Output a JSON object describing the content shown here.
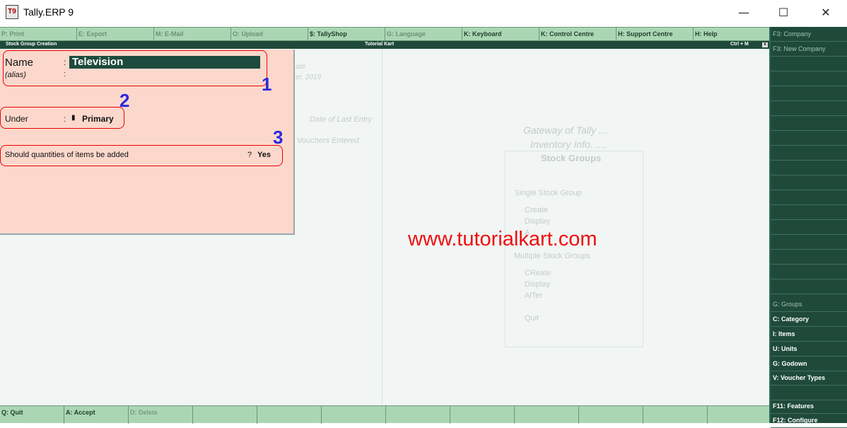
{
  "window": {
    "title": "Tally.ERP 9",
    "icon_label": "T9",
    "minimize": "—",
    "maximize": "☐",
    "close": "✕"
  },
  "top_menu": [
    {
      "label": "P: Print",
      "dim": true
    },
    {
      "label": "E: Export",
      "dim": true
    },
    {
      "label": "M: E-Mail",
      "dim": true
    },
    {
      "label": "O: Upload",
      "dim": true
    },
    {
      "label": "$: TallyShop",
      "dim": false
    },
    {
      "label": "G: Language",
      "dim": true
    },
    {
      "label": "K: Keyboard",
      "dim": false
    },
    {
      "label": "K: Control Centre",
      "dim": false
    },
    {
      "label": "H: Support Centre",
      "dim": false
    },
    {
      "label": "H: Help",
      "dim": false
    }
  ],
  "header": {
    "left": "Stock Group Creation",
    "center": "Tutorial Kart",
    "right": "Ctrl + M",
    "box": "x"
  },
  "form": {
    "name_label": "Name",
    "name_value": "Television",
    "alias_label": "(alias)",
    "colon": ":",
    "under_label": "Under",
    "under_value": "Primary",
    "under_marker": "▮",
    "quantity_label": "Should quantities of items be added",
    "quantity_prompt": "?",
    "quantity_value": "Yes"
  },
  "callouts": [
    "1",
    "2",
    "3"
  ],
  "background": {
    "ghost_date_1": "ate",
    "ghost_date_2": "er, 2019",
    "date_last_entry": "Date of Last Entry",
    "vouchers_entered": "Vouchers Entered",
    "gateway": "Gateway of Tally ....",
    "inventory": "Inventory Info. ....",
    "stock_groups": "Stock Groups",
    "single": "Single Stock Group",
    "create": "Create",
    "display": "Display",
    "alter_partial": "A",
    "multiple": "Multiple Stock Groups",
    "m_create": "CReate",
    "m_display": "Display",
    "m_alter": "AlTer",
    "quit": "Quit"
  },
  "watermark": "www.tutorialkart.com",
  "right_panel": [
    {
      "label": "F3: Company",
      "dim": true,
      "bold": false
    },
    {
      "label": "F3: New Company",
      "dim": true,
      "bold": false
    },
    {
      "label": "",
      "dim": false,
      "bold": false
    },
    {
      "label": "",
      "dim": false,
      "bold": false
    },
    {
      "label": "",
      "dim": false,
      "bold": false
    },
    {
      "label": "",
      "dim": false,
      "bold": false
    },
    {
      "label": "",
      "dim": false,
      "bold": false
    },
    {
      "label": "",
      "dim": false,
      "bold": false
    },
    {
      "label": "",
      "dim": false,
      "bold": false
    },
    {
      "label": "",
      "dim": false,
      "bold": false
    },
    {
      "label": "",
      "dim": false,
      "bold": false
    },
    {
      "label": "",
      "dim": false,
      "bold": false
    },
    {
      "label": "",
      "dim": false,
      "bold": false
    },
    {
      "label": "",
      "dim": false,
      "bold": false
    },
    {
      "label": "",
      "dim": false,
      "bold": false
    },
    {
      "label": "",
      "dim": false,
      "bold": false
    },
    {
      "label": "",
      "dim": false,
      "bold": false
    },
    {
      "label": "",
      "dim": false,
      "bold": false
    },
    {
      "label": "G: Groups",
      "dim": true,
      "bold": false
    },
    {
      "label": "C: Category",
      "dim": false,
      "bold": true
    },
    {
      "label": "I: Items",
      "dim": false,
      "bold": true
    },
    {
      "label": "U: Units",
      "dim": false,
      "bold": true
    },
    {
      "label": "G: Godown",
      "dim": false,
      "bold": true
    },
    {
      "label": "V: Voucher Types",
      "dim": false,
      "bold": true
    },
    {
      "label": "",
      "dim": false,
      "bold": false
    },
    {
      "label": "F11: Features",
      "dim": false,
      "bold": true
    },
    {
      "label": "F12: Configure",
      "dim": false,
      "bold": true
    }
  ],
  "bottom_menu": [
    {
      "label": "Q: Quit",
      "dim": false
    },
    {
      "label": "A: Accept",
      "dim": false
    },
    {
      "label": "D: Delete",
      "dim": true
    },
    {
      "label": "",
      "dim": false
    },
    {
      "label": "",
      "dim": false
    },
    {
      "label": "",
      "dim": false
    },
    {
      "label": "",
      "dim": false
    },
    {
      "label": "",
      "dim": false
    },
    {
      "label": "",
      "dim": false
    },
    {
      "label": "",
      "dim": false
    },
    {
      "label": "",
      "dim": false
    },
    {
      "label": "",
      "dim": false
    }
  ]
}
